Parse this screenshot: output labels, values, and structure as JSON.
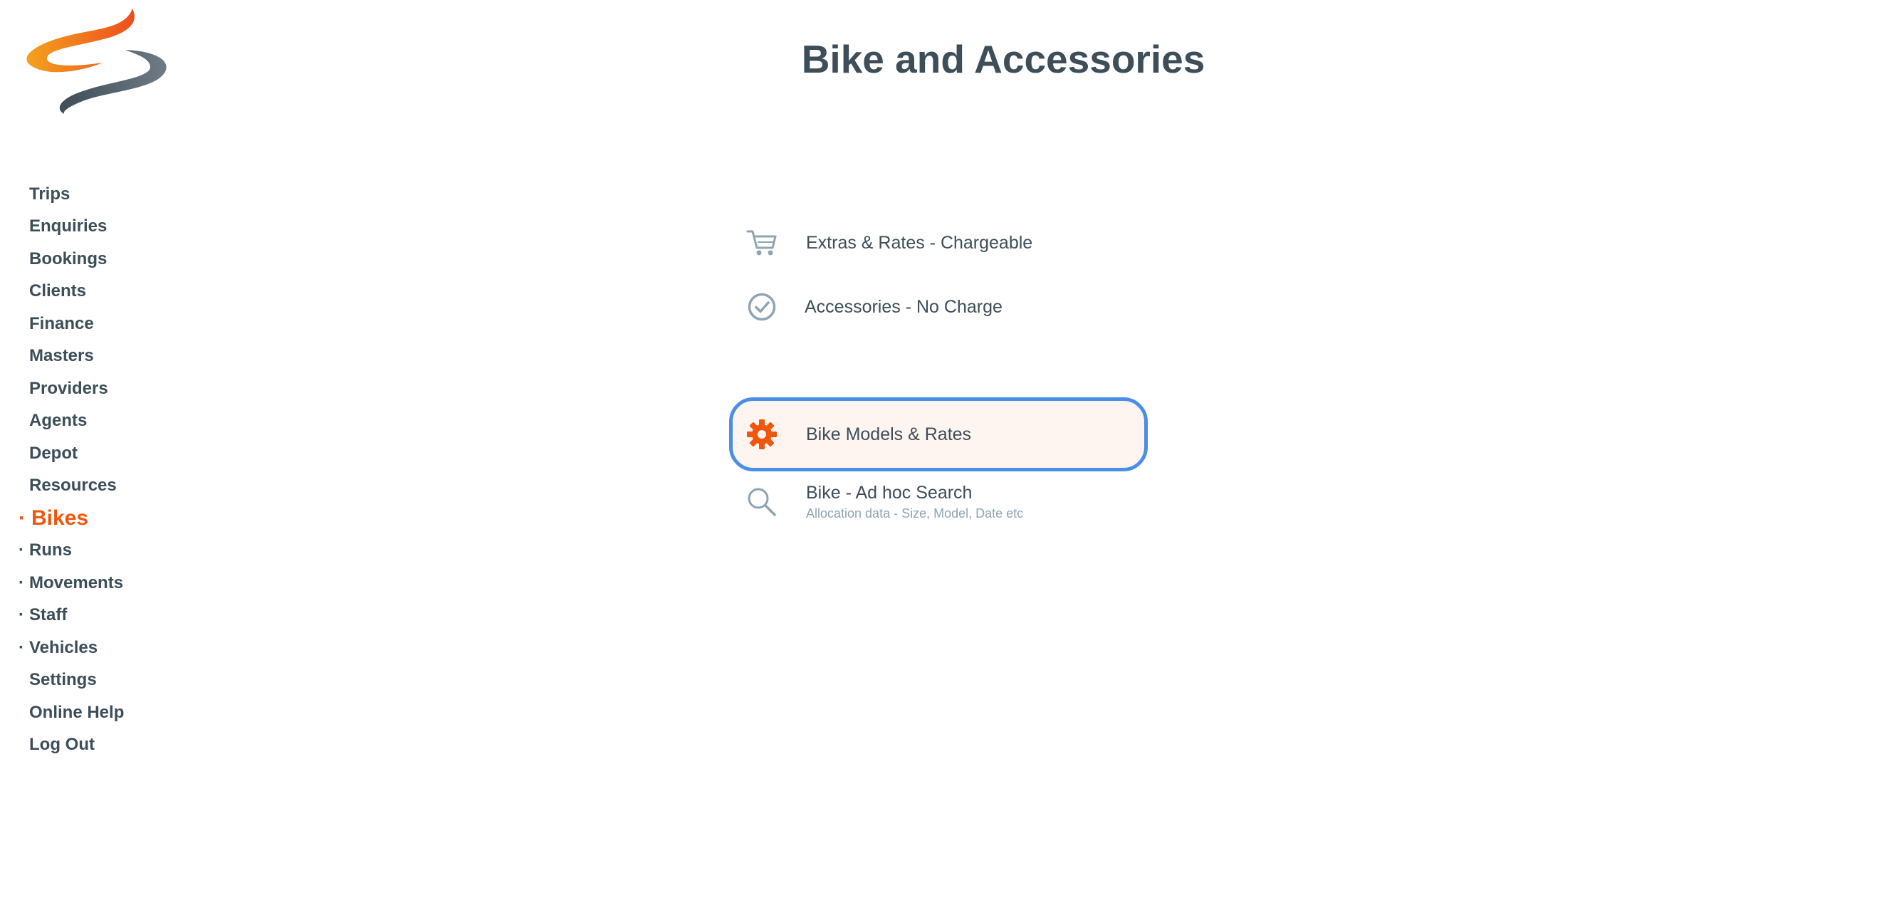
{
  "page": {
    "title": "Bike and Accessories"
  },
  "sidebar": {
    "items": [
      {
        "label": "Trips",
        "bullet": ""
      },
      {
        "label": "Enquiries",
        "bullet": ""
      },
      {
        "label": "Bookings",
        "bullet": ""
      },
      {
        "label": "Clients",
        "bullet": ""
      },
      {
        "label": "Finance",
        "bullet": ""
      },
      {
        "label": "Masters",
        "bullet": ""
      },
      {
        "label": "Providers",
        "bullet": ""
      },
      {
        "label": "Agents",
        "bullet": ""
      },
      {
        "label": "Depot",
        "bullet": ""
      },
      {
        "label": "Resources",
        "bullet": ""
      },
      {
        "label": "Bikes",
        "bullet": "·",
        "active": true
      },
      {
        "label": "Runs",
        "bullet": "·"
      },
      {
        "label": "Movements",
        "bullet": "·"
      },
      {
        "label": "Staff",
        "bullet": "·"
      },
      {
        "label": "Vehicles",
        "bullet": "·"
      },
      {
        "label": "Settings",
        "bullet": ""
      },
      {
        "label": "Online Help",
        "bullet": ""
      },
      {
        "label": "Log Out",
        "bullet": ""
      }
    ]
  },
  "menu": {
    "items": [
      {
        "label": "Extras & Rates - Chargeable",
        "icon": "cart-icon"
      },
      {
        "label": "Accessories - No Charge",
        "icon": "check-circle-icon"
      },
      {
        "label": "Bike Models & Rates",
        "icon": "gear-icon",
        "selected": true
      },
      {
        "label": "Bike - Ad hoc Search",
        "sub": "Allocation data - Size, Model, Date etc",
        "icon": "search-icon"
      }
    ]
  },
  "colors": {
    "text": "#3d4e58",
    "accent": "#f0570d",
    "icon_grey": "#8ea5b3",
    "focus_ring": "#4a8ee8",
    "selected_bg": "#fef5f1"
  }
}
